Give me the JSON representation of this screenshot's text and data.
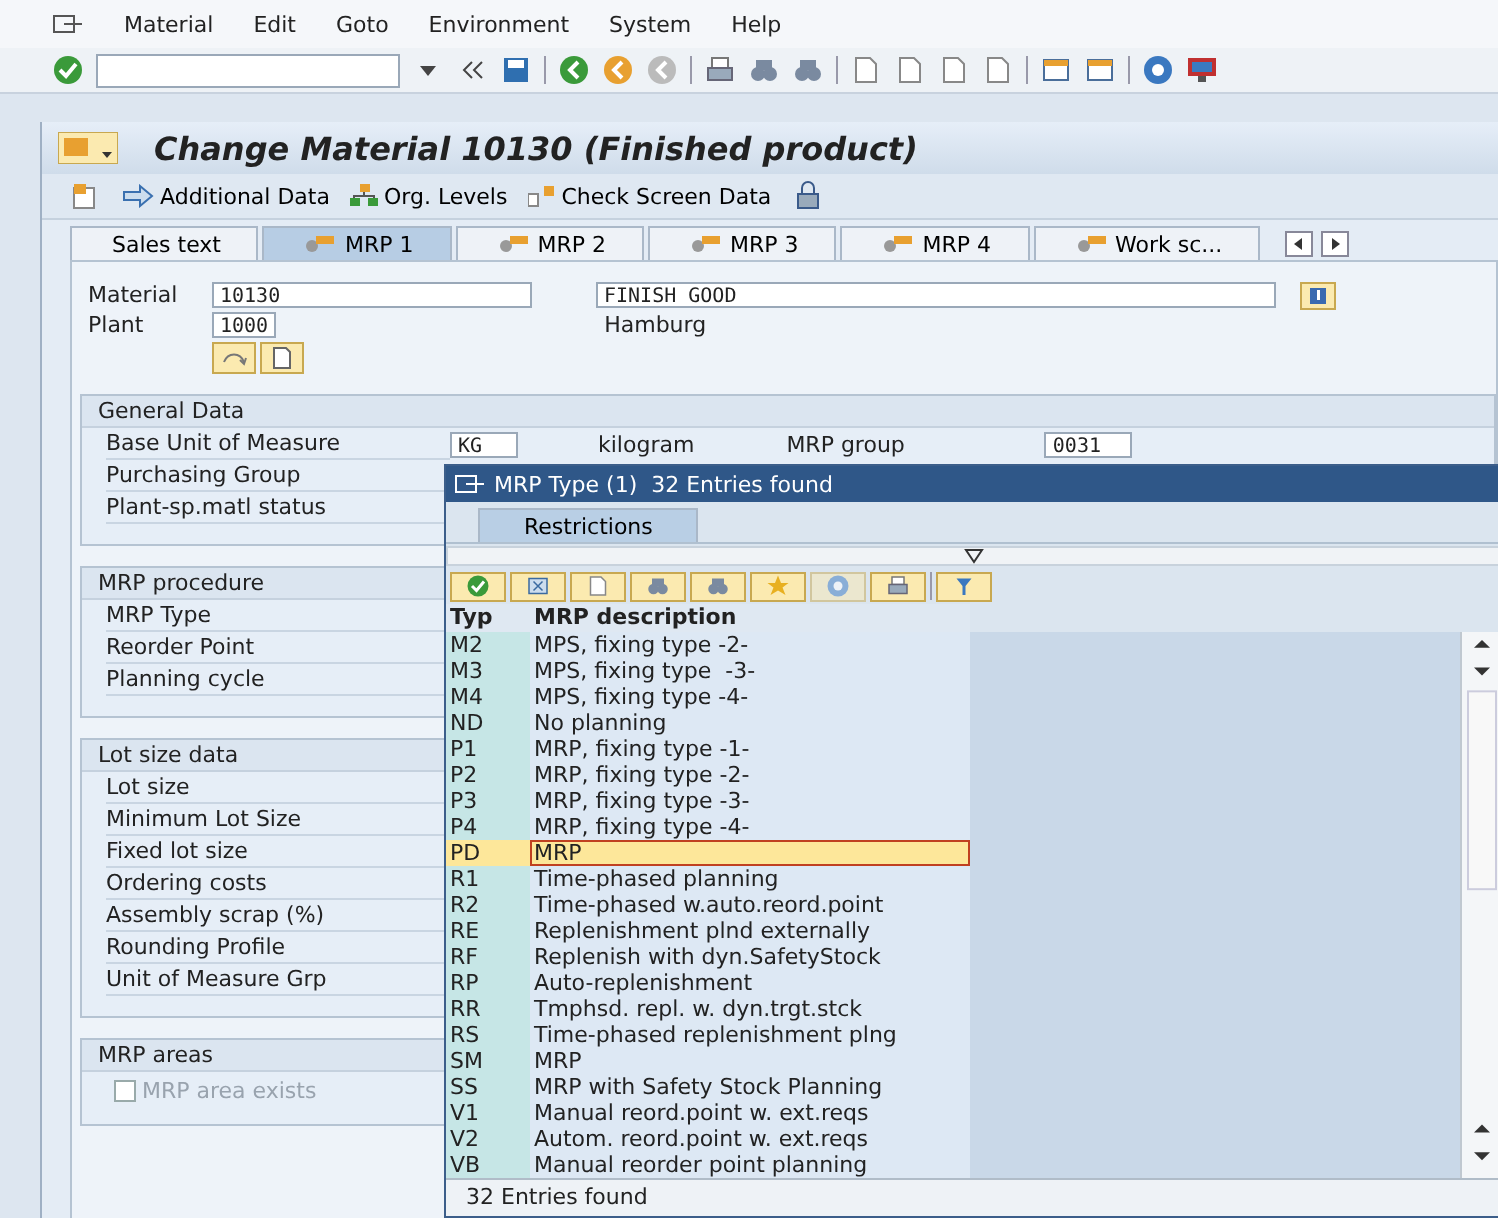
{
  "menu": [
    {
      "label": "Material"
    },
    {
      "label": "Edit"
    },
    {
      "label": "Goto"
    },
    {
      "label": "Environment"
    },
    {
      "label": "System"
    },
    {
      "label": "Help"
    }
  ],
  "title": "Change Material 10130 (Finished product)",
  "app_toolbar": [
    {
      "label": "Additional Data"
    },
    {
      "label": "Org. Levels"
    },
    {
      "label": "Check Screen Data"
    }
  ],
  "tabs": [
    {
      "label": "Sales text",
      "selected": false
    },
    {
      "label": "MRP 1",
      "selected": true
    },
    {
      "label": "MRP 2",
      "selected": false
    },
    {
      "label": "MRP 3",
      "selected": false
    },
    {
      "label": "MRP 4",
      "selected": false
    },
    {
      "label": "Work sc...",
      "selected": false
    }
  ],
  "header": {
    "material_label": "Material",
    "material": "10130",
    "description": "FINISH GOOD",
    "plant_label": "Plant",
    "plant": "1000",
    "plant_name": "Hamburg"
  },
  "groups": [
    {
      "title": "General Data",
      "rows": [
        {
          "label": "Base Unit of Measure",
          "value": "KG",
          "value_text": "kilogram",
          "extra_label": "MRP group",
          "extra_value": "0031"
        },
        {
          "label": "Purchasing Group"
        },
        {
          "label": "Plant-sp.matl status"
        }
      ]
    },
    {
      "title": "MRP procedure",
      "rows": [
        {
          "label": "MRP Type"
        },
        {
          "label": "Reorder Point"
        },
        {
          "label": "Planning cycle"
        }
      ]
    },
    {
      "title": "Lot size data",
      "rows": [
        {
          "label": "Lot size"
        },
        {
          "label": "Minimum Lot Size"
        },
        {
          "label": "Fixed lot size"
        },
        {
          "label": "Ordering costs"
        },
        {
          "label": "Assembly scrap (%)"
        },
        {
          "label": "Rounding Profile"
        },
        {
          "label": "Unit of Measure Grp"
        }
      ]
    },
    {
      "title": "MRP areas",
      "checkboxes": [
        {
          "label": "MRP area exists",
          "checked": false,
          "disabled": true
        }
      ]
    }
  ],
  "popup": {
    "title": "MRP Type (1)  32 Entries found",
    "tabs": [
      {
        "label": "Restrictions",
        "selected": true
      }
    ],
    "columns": [
      "Typ",
      "MRP description"
    ],
    "rows": [
      {
        "code": "M2",
        "description": "MPS, fixing type -2-",
        "selected": false
      },
      {
        "code": "M3",
        "description": "MPS, fixing type  -3-",
        "selected": false
      },
      {
        "code": "M4",
        "description": "MPS, fixing type -4-",
        "selected": false
      },
      {
        "code": "ND",
        "description": "No planning",
        "selected": false
      },
      {
        "code": "P1",
        "description": "MRP, fixing type -1-",
        "selected": false
      },
      {
        "code": "P2",
        "description": "MRP, fixing type -2-",
        "selected": false
      },
      {
        "code": "P3",
        "description": "MRP, fixing type -3-",
        "selected": false
      },
      {
        "code": "P4",
        "description": "MRP, fixing type -4-",
        "selected": false
      },
      {
        "code": "PD",
        "description": "MRP",
        "selected": true
      },
      {
        "code": "R1",
        "description": "Time-phased planning",
        "selected": false
      },
      {
        "code": "R2",
        "description": "Time-phased w.auto.reord.point",
        "selected": false
      },
      {
        "code": "RE",
        "description": "Replenishment plnd externally",
        "selected": false
      },
      {
        "code": "RF",
        "description": "Replenish with dyn.SafetyStock",
        "selected": false
      },
      {
        "code": "RP",
        "description": "Auto-replenishment",
        "selected": false
      },
      {
        "code": "RR",
        "description": "Tmphsd. repl. w. dyn.trgt.stck",
        "selected": false
      },
      {
        "code": "RS",
        "description": "Time-phased replenishment plng",
        "selected": false
      },
      {
        "code": "SM",
        "description": "MRP",
        "selected": false
      },
      {
        "code": "SS",
        "description": "MRP with Safety Stock Planning",
        "selected": false
      },
      {
        "code": "V1",
        "description": "Manual reord.point w. ext.reqs",
        "selected": false
      },
      {
        "code": "V2",
        "description": "Autom. reord.point w. ext.reqs",
        "selected": false
      },
      {
        "code": "VB",
        "description": "Manual reorder point planning",
        "selected": false
      }
    ],
    "status": "32 Entries found"
  }
}
